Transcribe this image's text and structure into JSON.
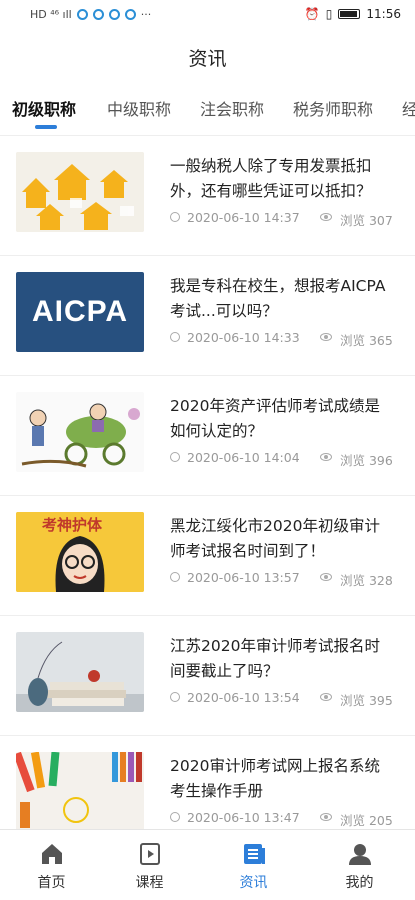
{
  "status_bar": {
    "left_text": "HD ⁴⁶ ıll",
    "time": "11:56"
  },
  "header": {
    "title": "资讯"
  },
  "tabs": [
    {
      "label": "初级职称",
      "active": true
    },
    {
      "label": "中级职称",
      "active": false
    },
    {
      "label": "注会职称",
      "active": false
    },
    {
      "label": "税务师职称",
      "active": false
    },
    {
      "label": "经",
      "active": false
    }
  ],
  "news": [
    {
      "title": "一般纳税人除了专用发票抵扣外，还有哪些凭证可以抵扣？",
      "date": "2020-06-10 14:37",
      "views": "浏览 307",
      "thumb": "houses"
    },
    {
      "title": "我是专科在校生，想报考AICPA考试...可以吗？",
      "date": "2020-06-10 14:33",
      "views": "浏览 365",
      "thumb": "aicpa",
      "thumb_text": "AICPA"
    },
    {
      "title": "2020年资产评估师考试成绩是如何认定的？",
      "date": "2020-06-10 14:04",
      "views": "浏览 396",
      "thumb": "cartoon-money"
    },
    {
      "title": "黑龙江绥化市2020年初级审计师考试报名时间到了！",
      "date": "2020-06-10 13:57",
      "views": "浏览 328",
      "thumb": "exam-girl",
      "thumb_text": "考神护体"
    },
    {
      "title": "江苏2020年审计师考试报名时间要截止了吗？",
      "date": "2020-06-10 13:54",
      "views": "浏览 395",
      "thumb": "books"
    },
    {
      "title": "2020审计师考试网上报名系统考生操作手册",
      "date": "2020-06-10 13:47",
      "views": "浏览 205",
      "thumb": "pencils"
    }
  ],
  "bottom_nav": [
    {
      "label": "首页",
      "icon": "home-icon",
      "active": false
    },
    {
      "label": "课程",
      "icon": "course-icon",
      "active": false
    },
    {
      "label": "资讯",
      "icon": "news-icon",
      "active": true
    },
    {
      "label": "我的",
      "icon": "profile-icon",
      "active": false
    }
  ],
  "colors": {
    "accent": "#2d7ed9",
    "meta": "#999999",
    "aicpa_bg": "#27507f"
  }
}
